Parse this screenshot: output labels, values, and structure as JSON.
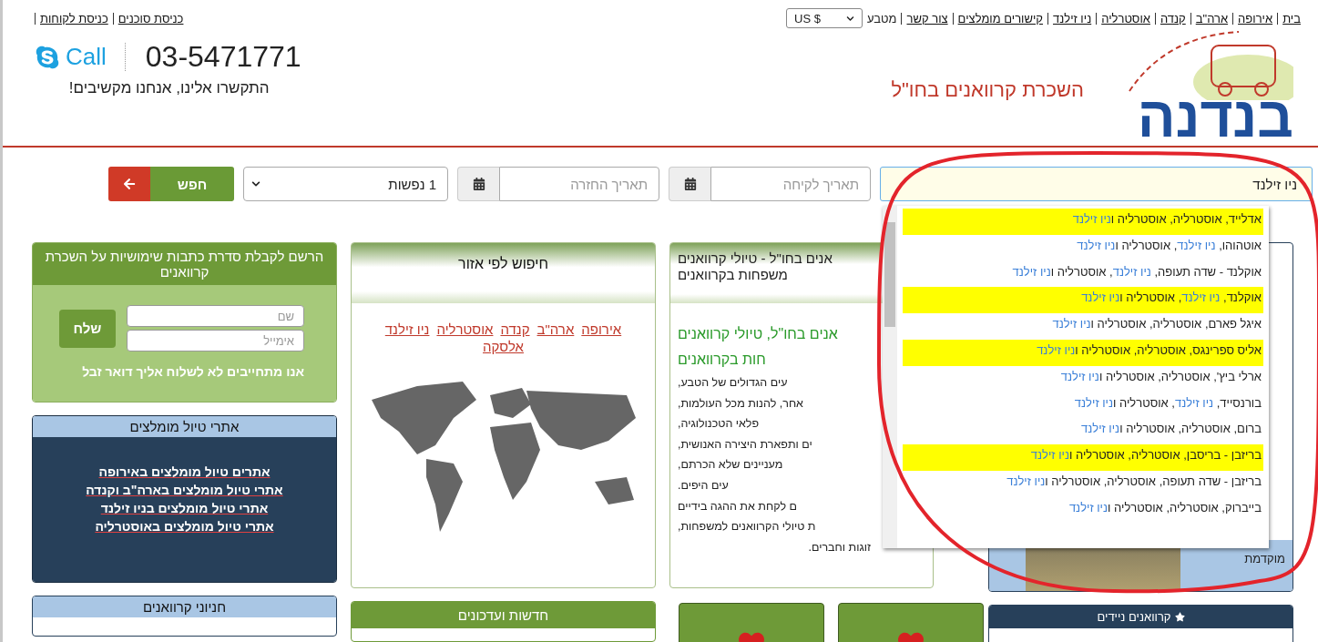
{
  "top_nav": {
    "links": [
      "בית",
      "אירופה",
      "ארה\"ב",
      "קנדה",
      "אוסטרליה",
      "ניו זילנד",
      "קישורים מומלצים",
      "צור קשר"
    ],
    "currency_label": "מטבע",
    "currency": "US $",
    "account_links": [
      "כניסת סוכנים",
      "כניסת לקוחות"
    ]
  },
  "header": {
    "logo": "בנדנה",
    "tagline": "השכרת קרוואנים בחו\"ל",
    "call_label": "Call",
    "phone": "03-5471771",
    "phone_note": "התקשרו אלינו, אנחנו מקשיבים!"
  },
  "search": {
    "location_value": "ניו זילנד",
    "pickup_placeholder": "תאריך לקיחה",
    "return_placeholder": "תאריך החזרה",
    "passengers": "1 נפשות",
    "button": "חפש"
  },
  "dropdown": {
    "items": [
      {
        "text": "אדלייד, אוסטרליה, אוסטרליה ו**ניו זילנד**",
        "highlighted": true
      },
      {
        "text": "אוטהוהו, **ניו זילנד**, אוסטרליה ו**ניו זילנד**",
        "highlighted": false
      },
      {
        "text": "אוקלנד - שדה תעופה, **ניו זילנד**, אוסטרליה ו**ניו זילנד**",
        "highlighted": false
      },
      {
        "text": "אוקלנד, **ניו זילנד**, אוסטרליה ו**ניו זילנד**",
        "highlighted": true
      },
      {
        "text": "איגל פארם, אוסטרליה, אוסטרליה ו**ניו זילנד**",
        "highlighted": false
      },
      {
        "text": "אליס ספרינגס, אוסטרליה, אוסטרליה ו**ניו זילנד**",
        "highlighted": true
      },
      {
        "text": "ארלי ביץ', אוסטרליה, אוסטרליה ו**ניו זילנד**",
        "highlighted": false
      },
      {
        "text": "בורנסייד, **ניו זילנד**, אוסטרליה ו**ניו זילנד**",
        "highlighted": false
      },
      {
        "text": "ברום, אוסטרליה, אוסטרליה ו**ניו זילנד**",
        "highlighted": false
      },
      {
        "text": "בריזבן - בריסבן, אוסטרליה, אוסטרליה ו**ניו זילנד**",
        "highlighted": true
      },
      {
        "text": "בריזבן - שדה תעופה, אוסטרליה, אוסטרליה ו**ניו זילנד**",
        "highlighted": false
      },
      {
        "text": "בייברוק, אוסטרליה, אוסטרליה ו**ניו זילנד**",
        "highlighted": false
      }
    ]
  },
  "newsletter": {
    "title": "הרשם לקבלת סדרת כתבות שימושיות על השכרת קרוואנים",
    "name_placeholder": "שם",
    "email_placeholder": "אימייל",
    "button": "שלח",
    "note": "אנו מתחייבים לא לשלוח אליך דואר זבל"
  },
  "recommended": {
    "title": "אתרי טיול מומלצים",
    "links": [
      "אתרים טיול מומלצים באירופה",
      "אתרי טיול מומלצים בארה\"ב וקנדה",
      "אתרי טיול מומלצים בניו זילנד",
      "אתרי טיול מומלצים באוסטרליה"
    ]
  },
  "region_search": {
    "title": "חיפוש לפי אזור",
    "links": [
      "אירופה",
      "ארה\"ב",
      "קנדה",
      "אוסטרליה",
      "ניו זילנד",
      "אלסקה"
    ]
  },
  "about": {
    "title_lines": [
      "אנים בחו\"ל - טיולי קרוואנים",
      "משפחות בקרוואנים"
    ],
    "lead_lines": [
      "אנים בחו\"ל, טיולי קרוואנים",
      "חות בקרוואנים"
    ],
    "lines": [
      "עים הגדולים של הטבע,",
      "אחר, להנות מכל העולמות,",
      "פלאי הטכנולוגיה,",
      "ים ותפארת היצירה האנושית,",
      "מעניינים שלא הכרתם,",
      "עים היפים.",
      "ם לקחת את ההגה בידיים",
      "ת טיולי הקרוואנים למשפחות,",
      "זוגות וחברים."
    ]
  },
  "deal_panel": {
    "caption": "מוקדמת"
  },
  "bottom": {
    "parks_title": "חניוני קרוואנים",
    "news_title": "חדשות ועדכונים",
    "mobile_title": "קרוואנים ניידים"
  }
}
